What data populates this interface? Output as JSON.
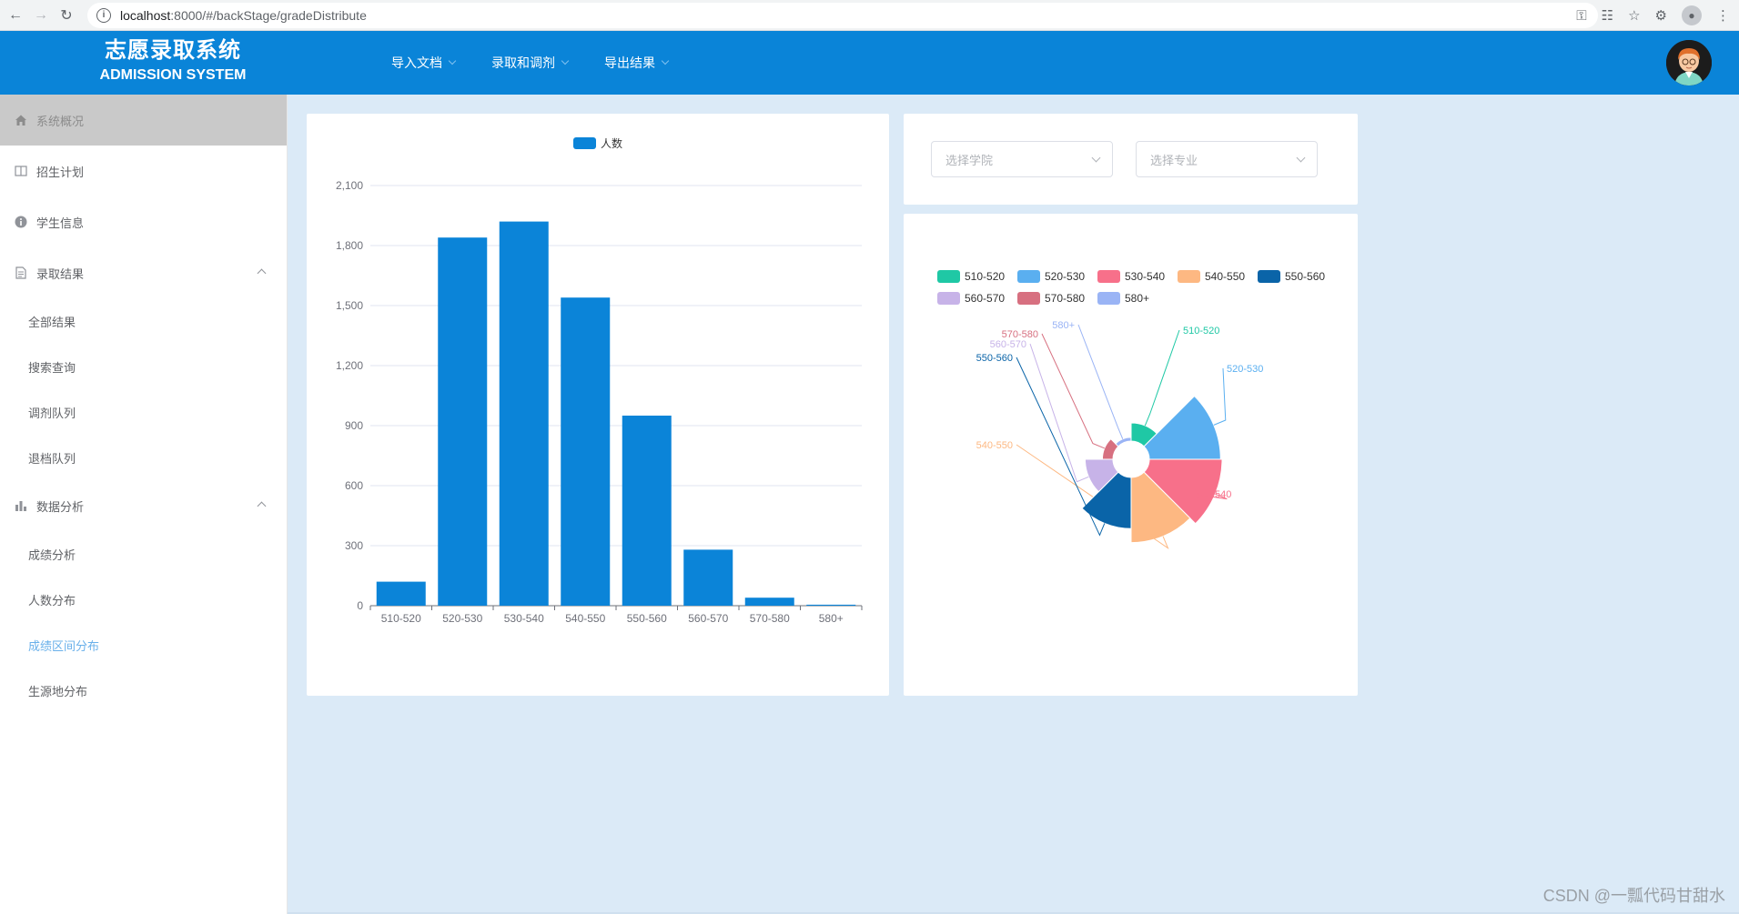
{
  "browser": {
    "url_host": "localhost",
    "url_path": ":8000/#/backStage/gradeDistribute"
  },
  "header": {
    "title_cn": "志愿录取系统",
    "title_en": "ADMISSION SYSTEM",
    "menu": [
      {
        "label": "导入文档"
      },
      {
        "label": "录取和调剂"
      },
      {
        "label": "导出结果"
      }
    ]
  },
  "sidebar": {
    "items": [
      {
        "label": "系统概况",
        "icon": "home-icon"
      },
      {
        "label": "招生计划",
        "icon": "book-icon"
      },
      {
        "label": "学生信息",
        "icon": "info-icon"
      },
      {
        "label": "录取结果",
        "icon": "document-icon"
      },
      {
        "label": "数据分析",
        "icon": "bar-chart-icon"
      }
    ],
    "result_sub": [
      "全部结果",
      "搜索查询",
      "调剂队列",
      "退档队列"
    ],
    "analysis_sub": [
      "成绩分析",
      "人数分布",
      "成绩区间分布",
      "生源地分布"
    ]
  },
  "filters": {
    "college_placeholder": "选择学院",
    "major_placeholder": "选择专业"
  },
  "colors": {
    "primary": "#0a84d8",
    "bar": "#0b84d8"
  },
  "chart_data": [
    {
      "type": "bar",
      "legend": [
        "人数"
      ],
      "categories": [
        "510-520",
        "520-530",
        "530-540",
        "540-550",
        "550-560",
        "560-570",
        "570-580",
        "580+"
      ],
      "series": [
        {
          "name": "人数",
          "values": [
            120,
            1840,
            1920,
            1540,
            950,
            280,
            40,
            5
          ]
        }
      ],
      "yticks": [
        "0",
        "300",
        "600",
        "900",
        "1,200",
        "1,500",
        "1,800",
        "2,100"
      ],
      "ylim": [
        0,
        2100
      ],
      "grid": true
    },
    {
      "type": "pie",
      "rose": true,
      "categories": [
        "510-520",
        "520-530",
        "530-540",
        "540-550",
        "550-560",
        "560-570",
        "570-580",
        "580+"
      ],
      "values": [
        120,
        1840,
        1920,
        1540,
        950,
        280,
        40,
        5
      ],
      "colors": [
        "#1fc8a5",
        "#5aaff0",
        "#f7708a",
        "#fdb882",
        "#0a64a8",
        "#c7b3e8",
        "#d77080",
        "#9ab4f5"
      ],
      "legend_position": "top-left"
    }
  ],
  "watermark": "CSDN @一瓢代码甘甜水"
}
